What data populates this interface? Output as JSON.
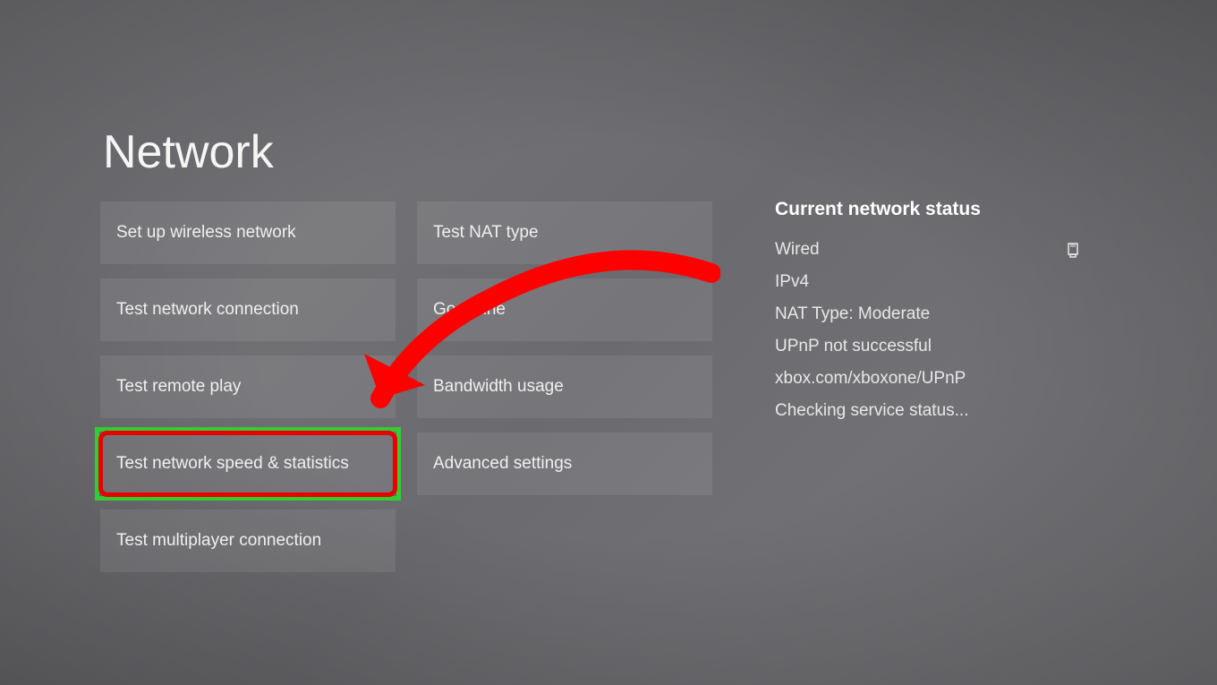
{
  "title": "Network",
  "leftColumn": [
    {
      "label": "Set up wireless network"
    },
    {
      "label": "Test network connection"
    },
    {
      "label": "Test remote play"
    },
    {
      "label": "Test network speed & statistics"
    },
    {
      "label": "Test multiplayer connection"
    }
  ],
  "rightColumn": [
    {
      "label": "Test NAT type"
    },
    {
      "label": "Go offline"
    },
    {
      "label": "Bandwidth usage"
    },
    {
      "label": "Advanced settings"
    }
  ],
  "status": {
    "heading": "Current network status",
    "lines": [
      "Wired",
      "IPv4",
      "NAT Type: Moderate",
      "UPnP not successful",
      "xbox.com/xboxone/UPnP",
      "Checking service status..."
    ]
  }
}
